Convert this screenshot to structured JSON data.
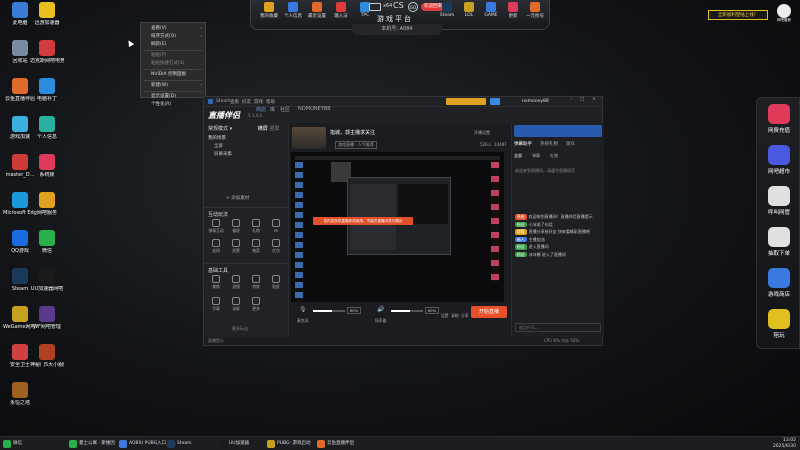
{
  "desktop_icons": [
    {
      "label": "此电脑",
      "icon": "computer-icon",
      "color": "#3a7bd5"
    },
    {
      "label": "迅游加速器",
      "icon": "xunyou-icon",
      "color": "#e8c020"
    },
    {
      "label": "回收站",
      "icon": "recycle-bin-icon",
      "color": "#7a8aa0"
    },
    {
      "label": "迈克斯网吧电竞中心",
      "icon": "net-cafe-icon",
      "color": "#d23b3b"
    },
    {
      "label": "云鱼直播伴侣",
      "icon": "fish-icon",
      "color": "#e06a2a"
    },
    {
      "label": "电脑补丁",
      "icon": "patch-icon",
      "color": "#2a8be0"
    },
    {
      "label": "游戏加速",
      "icon": "cloud-icon",
      "color": "#3ab0e0"
    },
    {
      "label": "个人信息",
      "icon": "id-card-icon",
      "color": "#2ab0a0"
    },
    {
      "label": "master_D...",
      "icon": "master-icon",
      "color": "#d03a3a"
    },
    {
      "label": "系统锁",
      "icon": "lock-icon",
      "color": "#e03a5a"
    },
    {
      "label": "Microsoft Edge",
      "icon": "edge-icon",
      "color": "#1a9ad8"
    },
    {
      "label": "网吧服务",
      "icon": "w-icon",
      "color": "#e0a020"
    },
    {
      "label": "QQ游戏",
      "icon": "qq-icon",
      "color": "#1a6ae0"
    },
    {
      "label": "微信",
      "icon": "wechat-icon",
      "color": "#2ab04a"
    },
    {
      "label": "Steam",
      "icon": "steam-icon",
      "color": "#1b3a5a"
    },
    {
      "label": "UU加速器网吧",
      "icon": "uu-icon",
      "color": "#1a1a1a"
    },
    {
      "label": "WeGame网吧专版",
      "icon": "wegame-icon",
      "color": "#c8a020"
    },
    {
      "label": "WF网吧管理",
      "icon": "wf-icon",
      "color": "#5a3a8a"
    },
    {
      "label": "安全卫士",
      "icon": "shield-icon",
      "color": "#d04040"
    },
    {
      "label": "神秘门5大小服网游加速",
      "icon": "game-icon",
      "color": "#b04020"
    },
    {
      "label": "永恒之塔",
      "icon": "aion-icon",
      "color": "#a06020"
    }
  ],
  "top_bar": {
    "items": [
      "我的收藏",
      "个人信息",
      "最近设置",
      "输入法",
      "TPC"
    ],
    "title": "游戏平台",
    "badge": "欢迎回来",
    "right_items": [
      "Steam",
      "LOL",
      "GAME",
      "更新",
      "一元抢号"
    ],
    "sub_tab": "本机号: A084",
    "center_icons": [
      "x64",
      "CS",
      "GO"
    ]
  },
  "context_menu": {
    "items": [
      "查看(V)",
      "排序方式(O)",
      "刷新(E)",
      "粘贴(P)",
      "粘贴快捷方式(S)",
      "NVIDIA 控制面板",
      "新建(W)",
      "显示设置(D)",
      "个性化(R)"
    ]
  },
  "top_right_badge": {
    "text": "全新福利登陆上线！",
    "logo": "网吧管家"
  },
  "right_dock": [
    {
      "label": "网费充值",
      "color": "#e03a5a"
    },
    {
      "label": "网吧超市",
      "color": "#4a5ae0"
    },
    {
      "label": "呼叫网管",
      "color": "#e0e0e0"
    },
    {
      "label": "抽取下单",
      "color": "#e0e0e0"
    },
    {
      "label": "游戏商店",
      "color": "#3a7ae0"
    },
    {
      "label": "陪玩",
      "color": "#e0c020"
    }
  ],
  "app_window": {
    "title_menu": [
      "Steam",
      "查看",
      "好友",
      "游戏",
      "帮助"
    ],
    "nav": [
      "商店",
      "库",
      "社区",
      "NOMONEYBB"
    ],
    "user": "nomoney88",
    "app_name": "直播伴侣",
    "version": "5.1.4.0",
    "stream_title": "指城，郭主播求关注",
    "category": "游戏直播 · 人气推荐",
    "stats": [
      "开播设置",
      "526人",
      "14487"
    ],
    "left": {
      "scene_header": "常规模式",
      "tabs": [
        "横屏",
        "竖屏"
      ],
      "add_source": "添加素材",
      "scene_items": [
        "我的场景",
        "全屏",
        "屏幕采集"
      ],
      "tools_header": "互动玩法",
      "tools": [
        "弹幕互动",
        "福袋",
        "礼物",
        "PK",
        "连线",
        "投票",
        "抽奖",
        "红包"
      ],
      "utility_header": "基础工具",
      "utilities": [
        "美颜",
        "滤镜",
        "特效",
        "贴纸",
        "字幕",
        "录屏",
        "更多"
      ],
      "more": "更多玩法"
    },
    "alert": "该内容仅供直播伴侣使用，不能在直播中进行展示",
    "bottom": {
      "mic_label": "麦克风",
      "mic_value": "60%",
      "speaker_label": "扬声器",
      "speaker_value": "60%",
      "buttons": [
        "设置",
        "录制",
        "分享"
      ],
      "start": "开始直播"
    },
    "status_left": "直播提示",
    "status_right": "CPU 8% 内存 50%",
    "right_panel": {
      "tabs": [
        "弹幕助手",
        "热榜礼物",
        "观众"
      ],
      "sub_tabs": [
        "全部",
        "弹幕",
        "礼物"
      ],
      "announcement": "欢迎来到直播间，请遵守直播规范",
      "messages": [
        {
          "tag": "系统",
          "text": "欢迎来到直播间！直播伴侣直播提示"
        },
        {
          "tag": "粉丝",
          "text": "小冰说了句话"
        },
        {
          "tag": "房管",
          "text": "直播分享给好友 快来看精彩直播吧"
        },
        {
          "tag": "新人",
          "text": "主播加油"
        },
        {
          "tag": "粉丝",
          "text": "进入直播间"
        },
        {
          "tag": "粉丝",
          "text": "冰冰酱 进入了直播间"
        }
      ],
      "input_placeholder": "说点什么..."
    }
  },
  "taskbar": {
    "weather": "微信",
    "apps": [
      {
        "label": "曼士公寓 · 斯维因",
        "color": "#2ab04a"
      },
      {
        "label": "AOBIU PUBG入口 全...",
        "color": "#3a7ae0"
      },
      {
        "label": "Steam",
        "color": "#1b3a5a"
      },
      {
        "label": "UU加速器",
        "color": "#1a1a1a"
      },
      {
        "label": "PUBG: 游戏启动",
        "color": "#c8a020"
      },
      {
        "label": "云鱼直播伴侣",
        "color": "#e06a2a"
      }
    ],
    "time": "13:02",
    "date": "2025/6/30"
  }
}
